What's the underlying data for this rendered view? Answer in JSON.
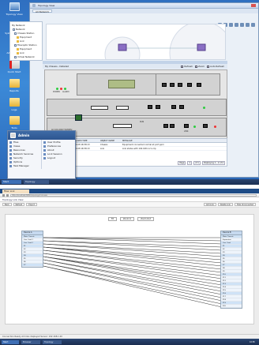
{
  "top": {
    "desktop_icons": [
      {
        "label": "Topology View",
        "icon": "network-icon"
      },
      {
        "label": "System Monitor",
        "icon": "server-icon"
      },
      {
        "label": "Admin Guide",
        "icon": "pdf-icon"
      },
      {
        "label": "Quick Start",
        "icon": "pdf-icon"
      },
      {
        "label": "Reports",
        "icon": "folder-icon"
      },
      {
        "label": "Logs",
        "icon": "folder-icon"
      },
      {
        "label": "Tools",
        "icon": "folder-icon"
      }
    ],
    "window": {
      "title": "Topology View",
      "tab": "All Network",
      "tree_title": "My Network",
      "tree_items": [
        "Network",
        "Chassis Station",
        "Equipment",
        "Link",
        "Fiberoptic Station",
        "Equipment",
        "Link",
        "Virtual Network"
      ],
      "detail_title": "My Chassis - Detailed",
      "detail_checks": [
        "Refresh",
        "Zoom",
        "Auto Refresh"
      ],
      "chassis_labels": [
        "POWER",
        "ALARM",
        "AC 100-240V 50/60Hz",
        "RUN",
        "LINK"
      ],
      "events": {
        "headers": [
          "SEVERITY",
          "LAST ALARM TIME",
          "OBJECT NAME",
          "MESSAGE"
        ],
        "rows": [
          [
            "Normal",
            "2014-10-08 16:58:13",
            "Chassis",
            "Equipment connected normal at port ppm"
          ],
          [
            "Normal",
            "2014-10-08 16:58:13",
            "Link",
            "Link status with 192.168.1.2 is Up"
          ]
        ],
        "pager": [
          "Page",
          "1",
          "of 1",
          "Displaying 1 - 2 of 2"
        ]
      }
    },
    "start_menu": {
      "user": "Admin",
      "left_items": [
        "Files",
        "Views",
        "Resources",
        "Network Services",
        "Security",
        "Options",
        "Task Manager"
      ],
      "right_items": [
        "User Profile",
        "Preferences",
        "About",
        "Lock Session",
        "Logout"
      ]
    },
    "taskbar": {
      "start": "Start",
      "tasks": [
        "Topology"
      ]
    }
  },
  "bottom": {
    "browser_tab": "Fiber Link",
    "url": "http://localhost:8080/topology/linkview",
    "app_title": "Topology Link View",
    "toolbar_buttons": [
      "Back",
      "Refresh",
      "Export"
    ],
    "toolbar_right": [
      "Add Link",
      "Delete Link",
      "Hide Unconnected"
    ],
    "zoom_buttons": [
      "Fit",
      "Zoom In",
      "Zoom Out"
    ],
    "left_device": {
      "title": "Device A",
      "groups": [
        "Main Chassis",
        "Line Card 1",
        "Line Card 2"
      ],
      "ports": [
        "P1",
        "P2",
        "P3",
        "P4",
        "P5",
        "P6",
        "P7"
      ]
    },
    "right_device": {
      "title": "Device B",
      "groups": [
        "Main Chassis",
        "Expansion",
        "Line Card"
      ],
      "ports": [
        "P1",
        "P2",
        "P3",
        "P4",
        "P5",
        "P6",
        "P7",
        "P8",
        "P9",
        "P10",
        "P11",
        "P12",
        "P13",
        "P14",
        "P15",
        "P16",
        "P17",
        "P18",
        "P19",
        "P20"
      ]
    },
    "status": "Connection Ready   All links displayed   Server: 192.168.1.20",
    "taskbar": {
      "start": "Start",
      "tasks": [
        "Browser",
        "Topology"
      ],
      "clock": "16:58"
    }
  }
}
